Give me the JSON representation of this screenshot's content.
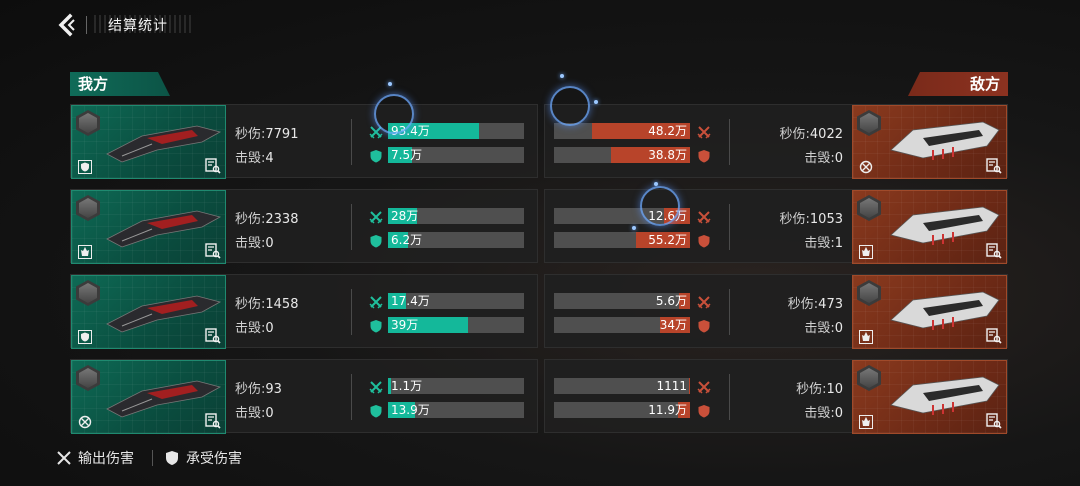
{
  "header": {
    "title": "结算统计"
  },
  "sides": {
    "ally_label": "我方",
    "enemy_label": "敌方"
  },
  "labels": {
    "dps": "秒伤:",
    "kills": "击毁:"
  },
  "legend": {
    "output": "输出伤害",
    "taken": "承受伤害"
  },
  "colors": {
    "ally": "#14b89a",
    "enemy": "#b8442a",
    "bar_bg": "#4f4f4f"
  },
  "ally": [
    {
      "dps": "7791",
      "kills": "4",
      "dealt": "93.4万",
      "dealt_pct": 67,
      "taken": "7.5万",
      "taken_pct": 18,
      "class_icon": "shield-icon"
    },
    {
      "dps": "2338",
      "kills": "0",
      "dealt": "28万",
      "dealt_pct": 21,
      "taken": "6.2万",
      "taken_pct": 15,
      "class_icon": "flame-icon"
    },
    {
      "dps": "1458",
      "kills": "0",
      "dealt": "17.4万",
      "dealt_pct": 13,
      "taken": "39万",
      "taken_pct": 59,
      "class_icon": "shield-icon"
    },
    {
      "dps": "93",
      "kills": "0",
      "dealt": "1.1万",
      "dealt_pct": 2,
      "taken": "13.9万",
      "taken_pct": 20,
      "class_icon": "target-icon"
    }
  ],
  "enemy": [
    {
      "dps": "4022",
      "kills": "0",
      "dealt": "48.2万",
      "dealt_pct": 72,
      "taken": "38.8万",
      "taken_pct": 58,
      "class_icon": "target-icon"
    },
    {
      "dps": "1053",
      "kills": "1",
      "dealt": "12.6万",
      "dealt_pct": 19,
      "taken": "55.2万",
      "taken_pct": 40,
      "class_icon": "flame-icon"
    },
    {
      "dps": "473",
      "kills": "0",
      "dealt": "5.6万",
      "dealt_pct": 8,
      "taken": "34万",
      "taken_pct": 22,
      "class_icon": "flame-icon"
    },
    {
      "dps": "10",
      "kills": "0",
      "dealt": "1111",
      "dealt_pct": 1,
      "taken": "11.9万",
      "taken_pct": 9,
      "class_icon": "flame-icon"
    }
  ]
}
